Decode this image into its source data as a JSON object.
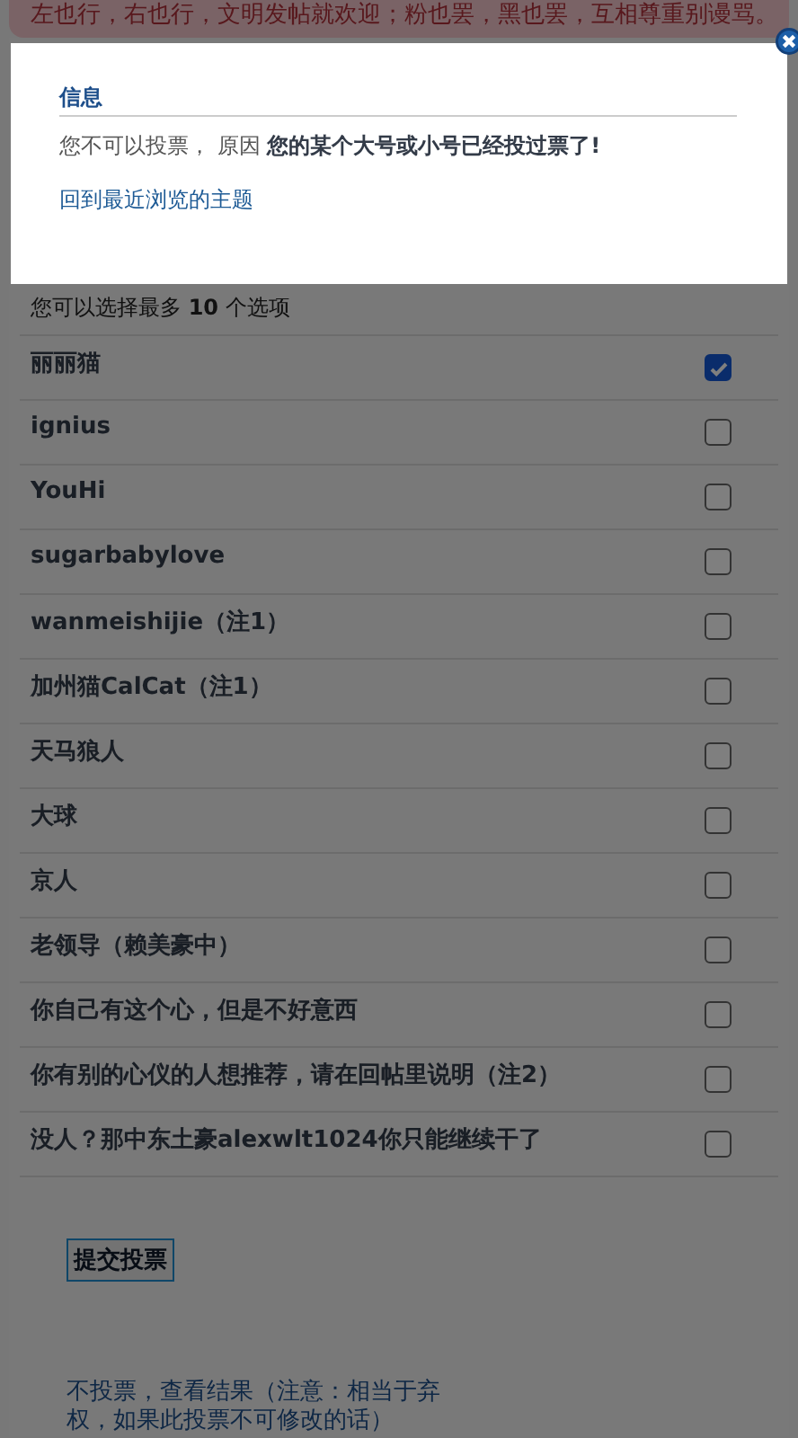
{
  "notice": {
    "text": "左也行，右也行，文明发帖就欢迎；粉也罢，黑也罢，互相尊重别谩骂。"
  },
  "poll": {
    "hint": "您可以选择最多 **10** 个选项",
    "options": [
      {
        "label": "丽丽猫",
        "checked": true
      },
      {
        "label": "ignius",
        "checked": false
      },
      {
        "label": "YouHi",
        "checked": false
      },
      {
        "label": "sugarbabylove",
        "checked": false
      },
      {
        "label": "wanmeishijie（注1）",
        "checked": false
      },
      {
        "label": "加州猫CalCat（注1）",
        "checked": false
      },
      {
        "label": "天马狼人",
        "checked": false
      },
      {
        "label": "大球",
        "checked": false
      },
      {
        "label": "京人",
        "checked": false
      },
      {
        "label": "老领导（赖美豪中）",
        "checked": false
      },
      {
        "label": "你自己有这个心，但是不好意西",
        "checked": false
      },
      {
        "label": "你有别的心仪的人想推荐，请在回帖里说明（注2）",
        "checked": false
      },
      {
        "label": "没人？那中东土豪alexwlt1024你只能继续干了",
        "checked": false
      }
    ],
    "submit": "提交投票",
    "abstain_link": "不投票，查看结果（注意：相当于弃权，如果此投票不可修改的话）"
  },
  "dialog": {
    "title": "信息",
    "message": "您不可以投票， 原因 **您的某个大号或小号已经投过票了!**",
    "link": "回到最近浏览的主题"
  }
}
